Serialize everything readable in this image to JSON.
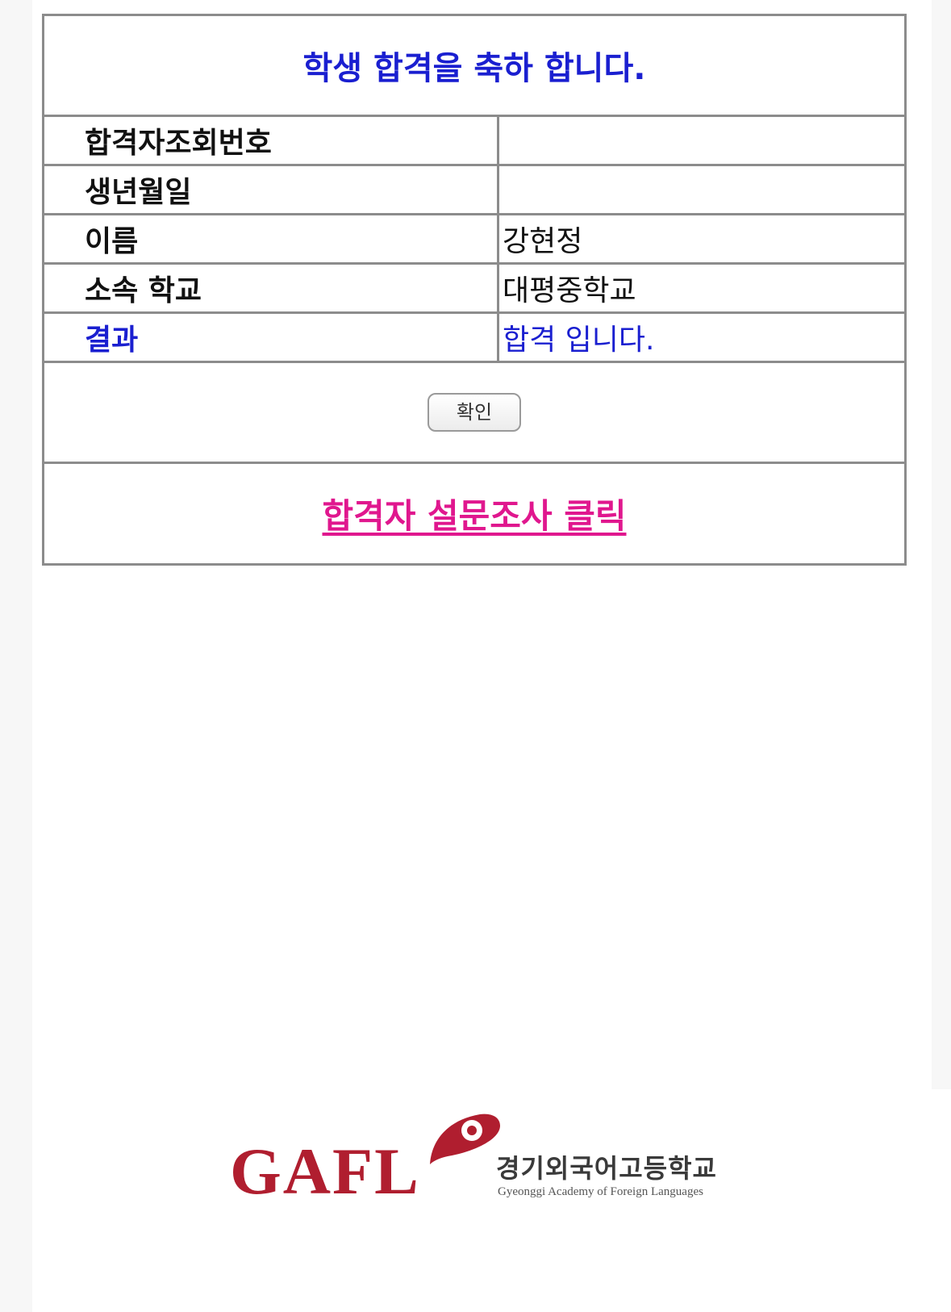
{
  "title": "학생 합격을 축하 합니다.",
  "rows": [
    {
      "label": "합격자조회번호",
      "value": ""
    },
    {
      "label": "생년월일",
      "value": ""
    },
    {
      "label": "이름",
      "value": "강현정"
    },
    {
      "label": "소속 학교",
      "value": "대평중학교"
    },
    {
      "label": "결과",
      "value": "합격 입니다."
    }
  ],
  "confirm_button": "확인",
  "survey_link": "합격자 설문조사 클릭",
  "logo": {
    "letters": "GAFL",
    "korean_name": "경기외국어고등학교",
    "english_name": "Gyeonggi Academy of Foreign Languages",
    "brand_color": "#b01e2f"
  },
  "colors": {
    "title": "#1a1fd0",
    "result": "#1a1fd0",
    "survey_link": "#e0178e"
  }
}
